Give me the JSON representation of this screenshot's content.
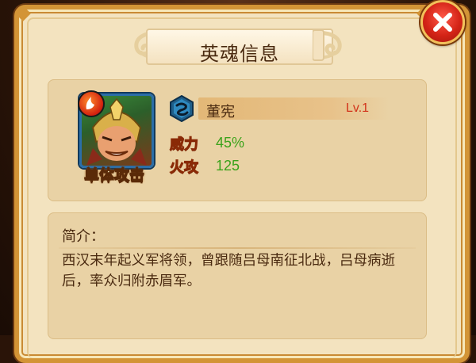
{
  "dialog": {
    "title": "英魂信息",
    "close_icon": "close-x-icon"
  },
  "hero": {
    "name": "董宪",
    "level": "Lv.1",
    "attack_type": "单体攻击",
    "element_icon": "fire-element-icon",
    "faction_icon": "faction-swirl-icon",
    "stats": [
      {
        "label": "威力",
        "value": "45%"
      },
      {
        "label": "火攻",
        "value": "125"
      }
    ]
  },
  "description": {
    "heading": "简介：",
    "text": "西汉末年起义军将领，曾跟随吕母南征北战，吕母病逝后，率众归附赤眉军。"
  },
  "colors": {
    "panel_bg": "#f3e3bf",
    "panel_border": "#d39436",
    "level_red": "#d2321a",
    "stat_green": "#3aa21a",
    "close_red": "#d42417"
  }
}
